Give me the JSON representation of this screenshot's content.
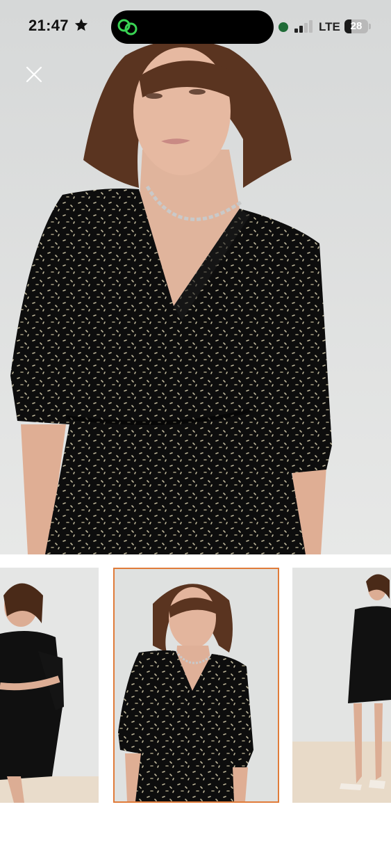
{
  "status_bar": {
    "time": "21:47",
    "network": "LTE",
    "battery": "28",
    "battery_fraction": 0.28,
    "icons": [
      "star-icon",
      "app-link-icon",
      "recording-dot-icon",
      "signal-bars-icon",
      "battery-icon"
    ]
  },
  "viewer": {
    "close_icon": "close-icon",
    "accent_color": "#e07b39",
    "selected_thumbnail": 2,
    "thumbnails": [
      {
        "name": "thumbnail-1"
      },
      {
        "name": "thumbnail-2"
      },
      {
        "name": "thumbnail-3"
      }
    ]
  }
}
